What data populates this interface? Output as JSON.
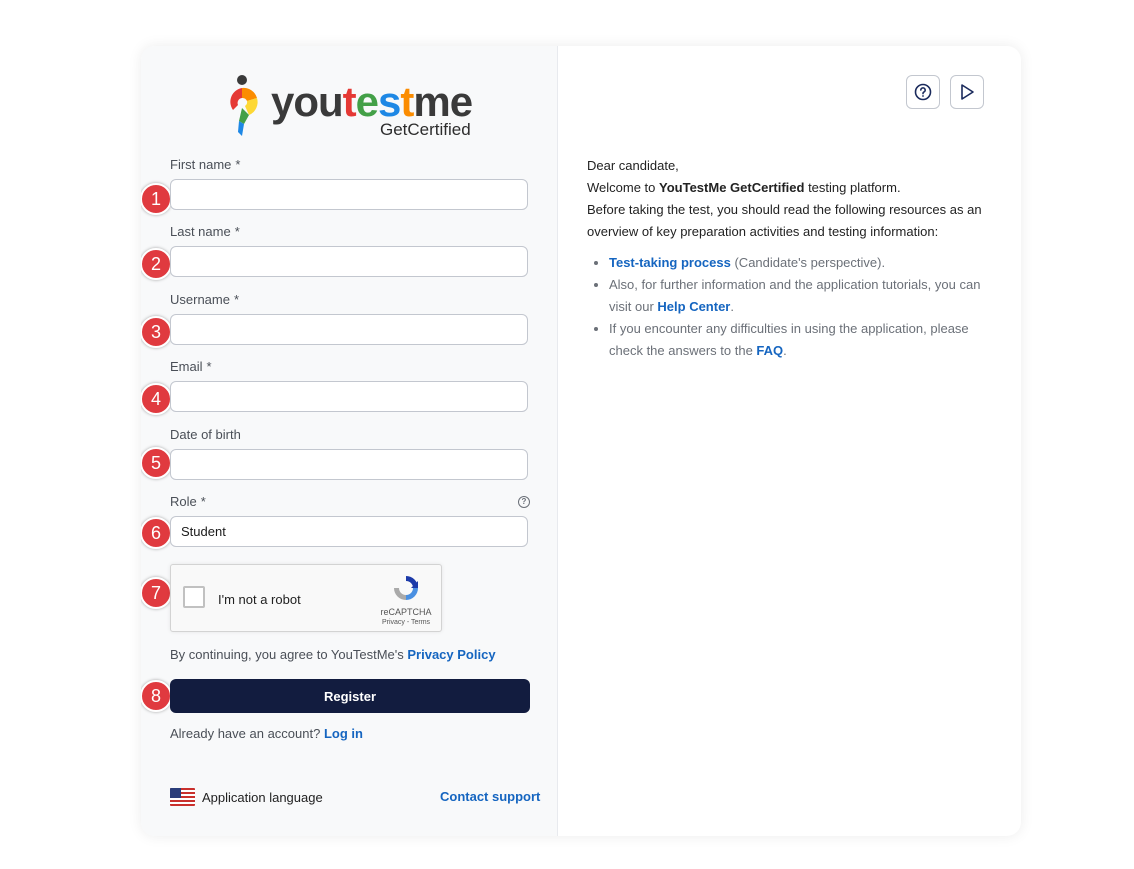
{
  "brand": {
    "word_you": "you",
    "word_test": "test",
    "word_me": "me",
    "subtitle": "GetCertified",
    "colors": {
      "you": "#3a3a3a",
      "test_t1": "#e53935",
      "test_e": "#43a047",
      "test_s": "#1e88e5",
      "test_t2": "#fb8c00",
      "me": "#3a3a3a"
    }
  },
  "form": {
    "first_name_label": "First name",
    "last_name_label": "Last name",
    "username_label": "Username",
    "email_label": "Email",
    "dob_label": "Date of birth",
    "role_label": "Role",
    "required_mark": "*",
    "role_value": "Student",
    "role_help_glyph": "?",
    "first_name_value": "",
    "last_name_value": "",
    "username_value": "",
    "email_value": "",
    "dob_value": ""
  },
  "badges": [
    "1",
    "2",
    "3",
    "4",
    "5",
    "6",
    "7",
    "8"
  ],
  "captcha": {
    "label": "I'm not a robot",
    "brand": "reCAPTCHA",
    "links": "Privacy - Terms"
  },
  "consent": {
    "text": "By continuing, you agree to YouTestMe's",
    "link": "Privacy Policy"
  },
  "register_label": "Register",
  "account": {
    "text": "Already have an account?",
    "link": "Log in"
  },
  "footer": {
    "language_label": "Application language",
    "support_link": "Contact support"
  },
  "toolbar": {
    "help_icon": "help-circle-icon",
    "play_icon": "play-icon"
  },
  "info": {
    "greeting": "Dear candidate,",
    "welcome_prefix": "Welcome to ",
    "welcome_brand": "YouTestMe GetCertified",
    "welcome_suffix": " testing platform.",
    "intro": "Before taking the test, you should read the following resources as an overview of key preparation activities and testing information:",
    "bullet1_link": "Test-taking process",
    "bullet1_text": " (Candidate's perspective).",
    "bullet2_text": "Also, for further information and the application tutorials, you can visit our ",
    "bullet2_link": "Help Center",
    "bullet2_end": ".",
    "bullet3_text": "If you encounter any difficulties in using the application, please check the answers to the ",
    "bullet3_link": "FAQ",
    "bullet3_end": "."
  }
}
